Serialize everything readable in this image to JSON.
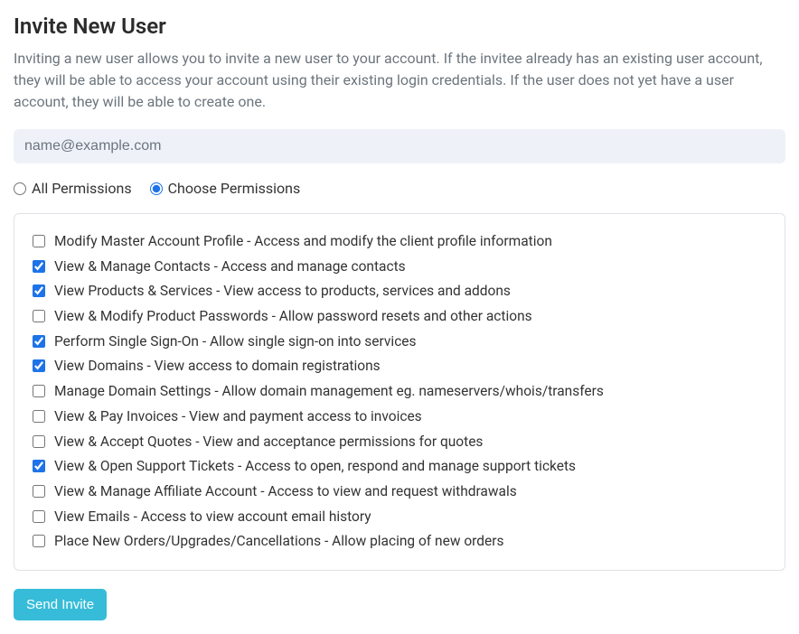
{
  "title": "Invite New User",
  "description": "Inviting a new user allows you to invite a new user to your account. If the invitee already has an existing user account, they will be able to access your account using their existing login credentials. If the user does not yet have a user account, they will be able to create one.",
  "email": {
    "placeholder": "name@example.com",
    "value": ""
  },
  "radio": {
    "all_label": "All Permissions",
    "choose_label": "Choose Permissions",
    "selected": "choose"
  },
  "permissions": [
    {
      "label": "Modify Master Account Profile - Access and modify the client profile information",
      "checked": false
    },
    {
      "label": "View & Manage Contacts - Access and manage contacts",
      "checked": true
    },
    {
      "label": "View Products & Services - View access to products, services and addons",
      "checked": true
    },
    {
      "label": "View & Modify Product Passwords - Allow password resets and other actions",
      "checked": false
    },
    {
      "label": "Perform Single Sign-On - Allow single sign-on into services",
      "checked": true
    },
    {
      "label": "View Domains - View access to domain registrations",
      "checked": true
    },
    {
      "label": "Manage Domain Settings - Allow domain management eg. nameservers/whois/transfers",
      "checked": false
    },
    {
      "label": "View & Pay Invoices - View and payment access to invoices",
      "checked": false
    },
    {
      "label": "View & Accept Quotes - View and acceptance permissions for quotes",
      "checked": false
    },
    {
      "label": "View & Open Support Tickets - Access to open, respond and manage support tickets",
      "checked": true
    },
    {
      "label": "View & Manage Affiliate Account - Access to view and request withdrawals",
      "checked": false
    },
    {
      "label": "View Emails - Access to view account email history",
      "checked": false
    },
    {
      "label": "Place New Orders/Upgrades/Cancellations - Allow placing of new orders",
      "checked": false
    }
  ],
  "button": {
    "send_label": "Send Invite"
  }
}
